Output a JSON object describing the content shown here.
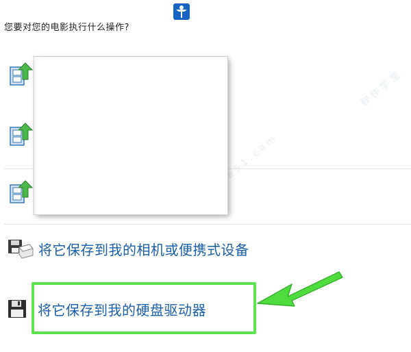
{
  "dialog": {
    "question": "您要对您的电影执行什么操作?",
    "options": [
      {
        "label": "将它保存到我的相机或便携式设备",
        "icon": "camera-device-save-icon"
      },
      {
        "label": "将它保存到我的硬盘驱动器",
        "icon": "floppy-disk-icon"
      }
    ],
    "film_options": [
      {
        "icon": "film-upload-icon"
      },
      {
        "icon": "film-upload-icon"
      },
      {
        "icon": "film-upload-icon"
      }
    ]
  },
  "colors": {
    "link": "#1a5fa8",
    "highlight": "#5fe24f",
    "arrow": "#4fdc3f"
  }
}
